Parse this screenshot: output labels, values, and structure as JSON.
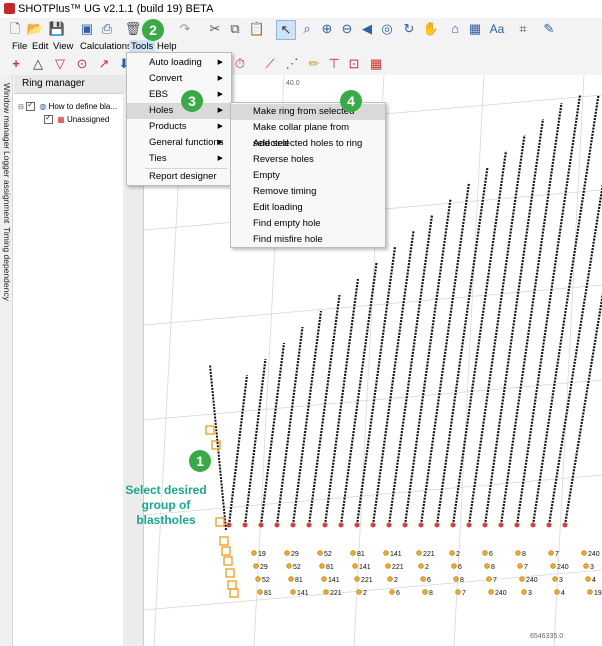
{
  "window": {
    "title": "SHOTPlus™ UG v2.1.1 (build 19) BETA"
  },
  "menubar": {
    "items": [
      "File",
      "Edit",
      "View",
      "Calculations",
      "Tools",
      "Help"
    ]
  },
  "side_tabs": [
    "Window manager",
    "Logger assignment",
    "Timing dependency"
  ],
  "ring_manager": {
    "title": "Ring manager",
    "pin_icon": "pin-icon",
    "tree": [
      {
        "label": "How to define bla...",
        "checked": true,
        "icon": "globe-icon"
      },
      {
        "label": "Unassigned",
        "checked": true,
        "icon": "grid-icon"
      }
    ]
  },
  "tools_menu": {
    "items": [
      {
        "label": "Auto loading",
        "submenu": true
      },
      {
        "label": "Convert",
        "submenu": true
      },
      {
        "label": "EBS",
        "submenu": true
      },
      {
        "label": "Holes",
        "submenu": true
      },
      {
        "label": "Products",
        "submenu": true
      },
      {
        "label": "General functions",
        "submenu": true
      },
      {
        "label": "Ties",
        "submenu": true
      },
      {
        "label": "Report designer",
        "submenu": false
      }
    ],
    "selected": "Holes"
  },
  "holes_submenu": {
    "items": [
      "Make ring from selected",
      "Make collar plane from selected",
      "Add selected holes to ring",
      "Reverse holes",
      "Empty",
      "Remove timing",
      "Edit loading",
      "Find empty hole",
      "Find misfire hole"
    ],
    "highlighted": "Make ring from selected"
  },
  "canvas": {
    "top_label": "40.0",
    "bottom_label": "6546335.0",
    "hole_labels": [
      "19",
      "29",
      "52",
      "81",
      "141",
      "221",
      "2",
      "6",
      "8",
      "7",
      "240",
      "3",
      "4"
    ]
  },
  "steps": {
    "step1": "1",
    "step2": "2",
    "step3": "3",
    "step4": "4",
    "annotation": "Select desired group of blastholes"
  },
  "colors": {
    "accent_green": "#3aaa47",
    "annotation": "#17a88d",
    "hole_marker": "#f5a623",
    "selection": "#f39c12"
  }
}
